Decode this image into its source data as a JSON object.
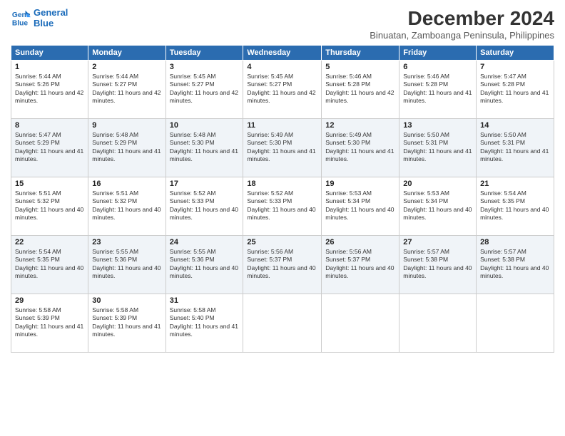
{
  "logo": {
    "line1": "General",
    "line2": "Blue"
  },
  "title": "December 2024",
  "location": "Binuatan, Zamboanga Peninsula, Philippines",
  "days_of_week": [
    "Sunday",
    "Monday",
    "Tuesday",
    "Wednesday",
    "Thursday",
    "Friday",
    "Saturday"
  ],
  "weeks": [
    [
      {
        "day": "1",
        "sunrise": "5:44 AM",
        "sunset": "5:26 PM",
        "daylight": "11 hours and 42 minutes."
      },
      {
        "day": "2",
        "sunrise": "5:44 AM",
        "sunset": "5:27 PM",
        "daylight": "11 hours and 42 minutes."
      },
      {
        "day": "3",
        "sunrise": "5:45 AM",
        "sunset": "5:27 PM",
        "daylight": "11 hours and 42 minutes."
      },
      {
        "day": "4",
        "sunrise": "5:45 AM",
        "sunset": "5:27 PM",
        "daylight": "11 hours and 42 minutes."
      },
      {
        "day": "5",
        "sunrise": "5:46 AM",
        "sunset": "5:28 PM",
        "daylight": "11 hours and 42 minutes."
      },
      {
        "day": "6",
        "sunrise": "5:46 AM",
        "sunset": "5:28 PM",
        "daylight": "11 hours and 41 minutes."
      },
      {
        "day": "7",
        "sunrise": "5:47 AM",
        "sunset": "5:28 PM",
        "daylight": "11 hours and 41 minutes."
      }
    ],
    [
      {
        "day": "8",
        "sunrise": "5:47 AM",
        "sunset": "5:29 PM",
        "daylight": "11 hours and 41 minutes."
      },
      {
        "day": "9",
        "sunrise": "5:48 AM",
        "sunset": "5:29 PM",
        "daylight": "11 hours and 41 minutes."
      },
      {
        "day": "10",
        "sunrise": "5:48 AM",
        "sunset": "5:30 PM",
        "daylight": "11 hours and 41 minutes."
      },
      {
        "day": "11",
        "sunrise": "5:49 AM",
        "sunset": "5:30 PM",
        "daylight": "11 hours and 41 minutes."
      },
      {
        "day": "12",
        "sunrise": "5:49 AM",
        "sunset": "5:30 PM",
        "daylight": "11 hours and 41 minutes."
      },
      {
        "day": "13",
        "sunrise": "5:50 AM",
        "sunset": "5:31 PM",
        "daylight": "11 hours and 41 minutes."
      },
      {
        "day": "14",
        "sunrise": "5:50 AM",
        "sunset": "5:31 PM",
        "daylight": "11 hours and 41 minutes."
      }
    ],
    [
      {
        "day": "15",
        "sunrise": "5:51 AM",
        "sunset": "5:32 PM",
        "daylight": "11 hours and 40 minutes."
      },
      {
        "day": "16",
        "sunrise": "5:51 AM",
        "sunset": "5:32 PM",
        "daylight": "11 hours and 40 minutes."
      },
      {
        "day": "17",
        "sunrise": "5:52 AM",
        "sunset": "5:33 PM",
        "daylight": "11 hours and 40 minutes."
      },
      {
        "day": "18",
        "sunrise": "5:52 AM",
        "sunset": "5:33 PM",
        "daylight": "11 hours and 40 minutes."
      },
      {
        "day": "19",
        "sunrise": "5:53 AM",
        "sunset": "5:34 PM",
        "daylight": "11 hours and 40 minutes."
      },
      {
        "day": "20",
        "sunrise": "5:53 AM",
        "sunset": "5:34 PM",
        "daylight": "11 hours and 40 minutes."
      },
      {
        "day": "21",
        "sunrise": "5:54 AM",
        "sunset": "5:35 PM",
        "daylight": "11 hours and 40 minutes."
      }
    ],
    [
      {
        "day": "22",
        "sunrise": "5:54 AM",
        "sunset": "5:35 PM",
        "daylight": "11 hours and 40 minutes."
      },
      {
        "day": "23",
        "sunrise": "5:55 AM",
        "sunset": "5:36 PM",
        "daylight": "11 hours and 40 minutes."
      },
      {
        "day": "24",
        "sunrise": "5:55 AM",
        "sunset": "5:36 PM",
        "daylight": "11 hours and 40 minutes."
      },
      {
        "day": "25",
        "sunrise": "5:56 AM",
        "sunset": "5:37 PM",
        "daylight": "11 hours and 40 minutes."
      },
      {
        "day": "26",
        "sunrise": "5:56 AM",
        "sunset": "5:37 PM",
        "daylight": "11 hours and 40 minutes."
      },
      {
        "day": "27",
        "sunrise": "5:57 AM",
        "sunset": "5:38 PM",
        "daylight": "11 hours and 40 minutes."
      },
      {
        "day": "28",
        "sunrise": "5:57 AM",
        "sunset": "5:38 PM",
        "daylight": "11 hours and 40 minutes."
      }
    ],
    [
      {
        "day": "29",
        "sunrise": "5:58 AM",
        "sunset": "5:39 PM",
        "daylight": "11 hours and 41 minutes."
      },
      {
        "day": "30",
        "sunrise": "5:58 AM",
        "sunset": "5:39 PM",
        "daylight": "11 hours and 41 minutes."
      },
      {
        "day": "31",
        "sunrise": "5:58 AM",
        "sunset": "5:40 PM",
        "daylight": "11 hours and 41 minutes."
      },
      null,
      null,
      null,
      null
    ]
  ]
}
